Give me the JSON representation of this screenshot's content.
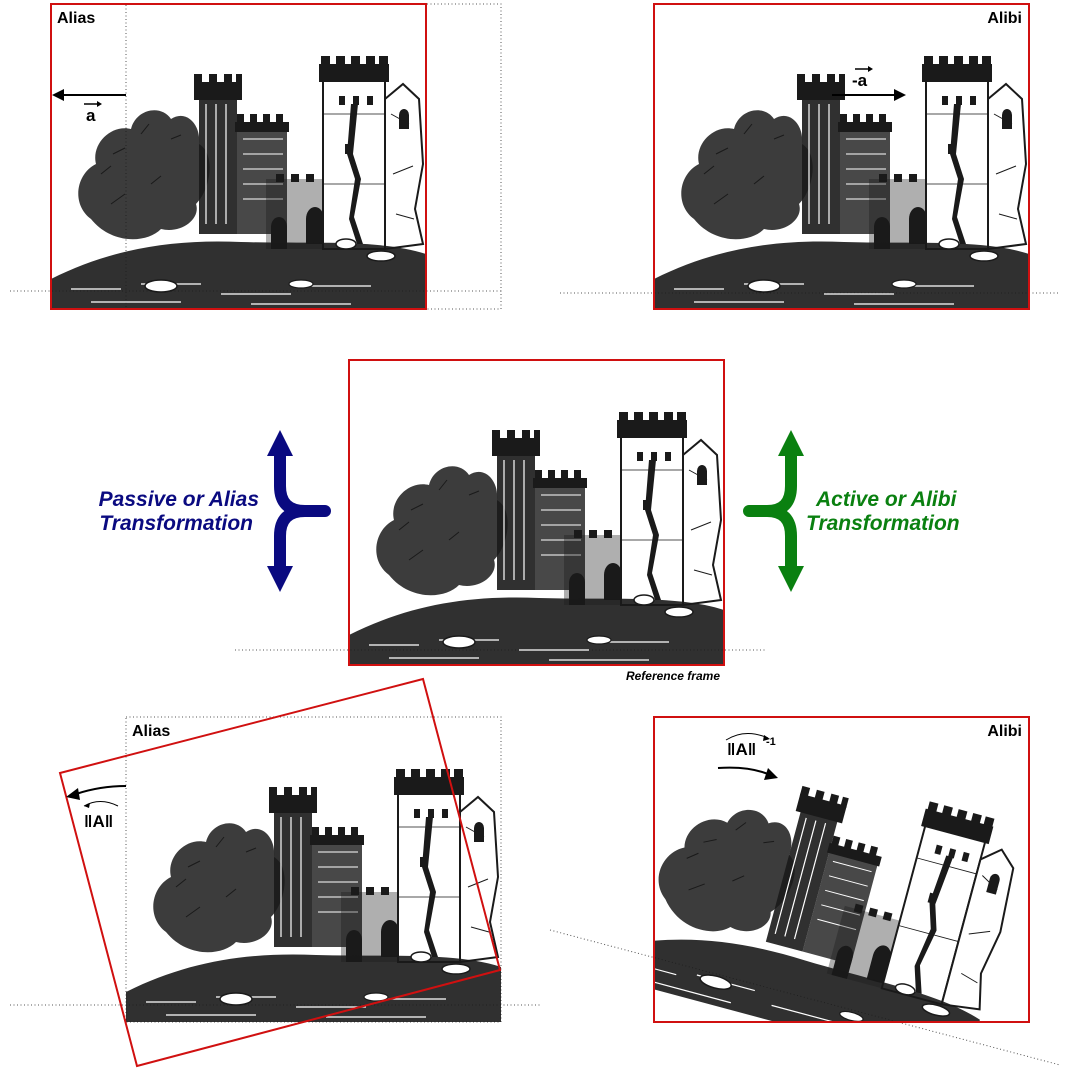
{
  "panels": {
    "top_left": {
      "title": "Alias",
      "vector_label": "a"
    },
    "top_right": {
      "title": "Alibi",
      "vector_label": "-a"
    },
    "center": {
      "caption": "Reference frame"
    },
    "bottom_left": {
      "title": "Alias",
      "operator_label": "‖A‖"
    },
    "bottom_right": {
      "title": "Alibi",
      "operator_label": "‖A‖",
      "superscript": "-1"
    }
  },
  "transforms": {
    "passive": {
      "line1": "Passive or Alias",
      "line2": "Transformation",
      "color": "#0a0a80"
    },
    "active": {
      "line1": "Active or Alibi",
      "line2": "Transformation",
      "color": "#0a8010"
    }
  },
  "colors": {
    "frame": "#d01010",
    "ink": "#1a1a1a"
  },
  "illustration": "castle-ruins"
}
